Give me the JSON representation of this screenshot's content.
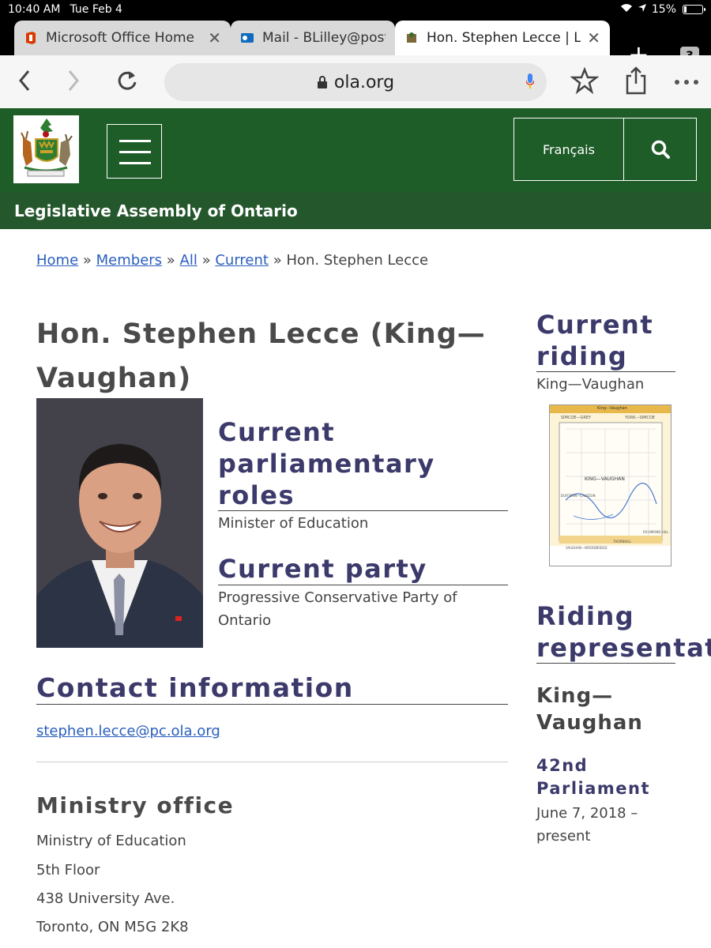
{
  "status": {
    "time": "10:40 AM",
    "date": "Tue Feb 4",
    "battery": "15%",
    "battery_level": 0.15
  },
  "tabs": [
    {
      "label": "Microsoft Office Home",
      "close": "✕"
    },
    {
      "label": "Mail - BLilley@postme",
      "close": ""
    },
    {
      "label": "Hon. Stephen Lecce | Leg",
      "close": "✕"
    }
  ],
  "tab_count": "3",
  "new_tab": "+",
  "address": {
    "url": "ola.org"
  },
  "site": {
    "language_button": "Français",
    "assembly_name": "Legislative Assembly of Ontario"
  },
  "breadcrumb": {
    "home": "Home",
    "members": "Members",
    "all": "All",
    "current": "Current",
    "sep": "»",
    "page": "Hon. Stephen Lecce"
  },
  "member": {
    "title": "Hon. Stephen Lecce (King—Vaughan)",
    "roles_heading": "Current parliamentary roles",
    "role": "Minister of Education",
    "party_heading": "Current party",
    "party": "Progressive Conservative Party of Ontario",
    "contact_heading": "Contact information",
    "email": "stephen.lecce@pc.ola.org",
    "office_heading": "Ministry office",
    "office_lines": [
      "Ministry of Education",
      "5th Floor",
      "438 University Ave.",
      "Toronto, ON M5G 2K8"
    ]
  },
  "sidebar": {
    "riding_heading": "Current riding",
    "riding": "King—Vaughan",
    "map": {
      "top_label": "King—Vaughan",
      "center_label": "KING—VAUGHAN",
      "region_labels": [
        "SIMCOE—GREY",
        "YORK—SIMCOE",
        "DUFFERIN—CALEDON",
        "VAUGHAN—WOODBRIDGE",
        "THORNHILL",
        "RICHMOND HILL"
      ]
    },
    "representation_heading": "Riding representation",
    "rep_riding": "King—Vaughan",
    "parliament": "42nd Parliament",
    "term": "June 7, 2018 – present"
  }
}
